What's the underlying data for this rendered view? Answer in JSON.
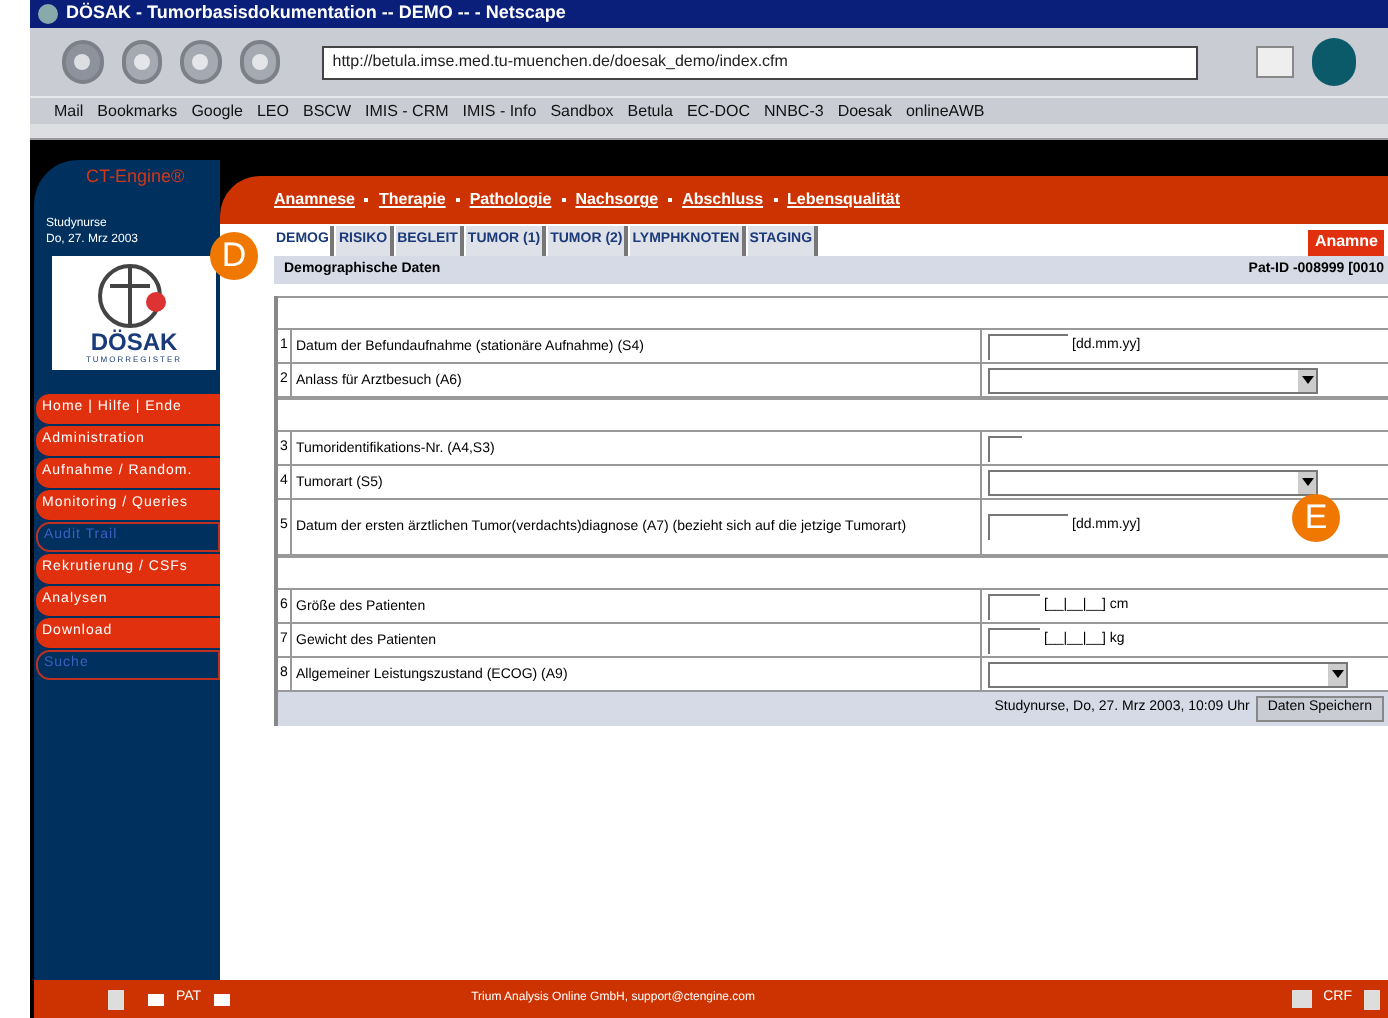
{
  "window": {
    "title": "DÖSAK - Tumorbasisdokumentation -- DEMO -- - Netscape"
  },
  "browser": {
    "url": "http://betula.imse.med.tu-muenchen.de/doesak_demo/index.cfm",
    "bookmarks": [
      "Mail",
      "Bookmarks",
      "Google",
      "LEO",
      "BSCW",
      "IMIS - CRM",
      "IMIS - Info",
      "Sandbox",
      "Betula",
      "EC-DOC",
      "NNBC-3",
      "Doesak",
      "onlineAWB"
    ]
  },
  "sidebar": {
    "brand": "CT-Engine®",
    "user": "Studynurse",
    "date": "Do, 27. Mrz 2003",
    "logo_text": "DÖSAK",
    "logo_subtext": "TUMORREGISTER",
    "items": [
      {
        "label": "Home  |  Hilfe  |  Ende",
        "disabled": false
      },
      {
        "label": "Administration",
        "disabled": false
      },
      {
        "label": "Aufnahme / Random.",
        "disabled": false
      },
      {
        "label": "Monitoring / Queries",
        "disabled": false
      },
      {
        "label": "Audit Trail",
        "disabled": true
      },
      {
        "label": "Rekrutierung / CSFs",
        "disabled": false
      },
      {
        "label": "Analysen",
        "disabled": false
      },
      {
        "label": "Download",
        "disabled": false
      },
      {
        "label": "Suche",
        "disabled": true
      }
    ]
  },
  "nav": [
    "Anamnese",
    "Therapie",
    "Pathologie",
    "Nachsorge",
    "Abschluss",
    "Lebensqualität"
  ],
  "tabs": [
    {
      "label": "DEMOG",
      "selected": true
    },
    {
      "label": "RISIKO",
      "selected": false
    },
    {
      "label": "BEGLEIT",
      "selected": false
    },
    {
      "label": "TUMOR (1)",
      "selected": false
    },
    {
      "label": "TUMOR (2)",
      "selected": false
    },
    {
      "label": "LYMPHKNOTEN",
      "selected": false
    },
    {
      "label": "STAGING",
      "selected": false
    }
  ],
  "section_button": "Anamne",
  "form": {
    "title": "Demographische Daten",
    "patient_id": "Pat-ID -008999 [0010",
    "rows": [
      {
        "kind": "spacer"
      },
      {
        "kind": "date",
        "number": "1",
        "label": "Datum der Befundaufnahme (stationäre Aufnahme) (S4)",
        "hint": "[dd.mm.yy]"
      },
      {
        "kind": "select",
        "number": "2",
        "label": "Anlass für Arztbesuch (A6)"
      },
      {
        "kind": "spacer"
      },
      {
        "kind": "short",
        "number": "3",
        "label": "Tumoridentifikations-Nr. (A4,S3)"
      },
      {
        "kind": "select",
        "number": "4",
        "label": "Tumorart (S5)"
      },
      {
        "kind": "date",
        "number": "5",
        "label": "Datum der ersten ärztlichen Tumor(verdachts)diagnose (A7) (bezieht sich auf die jetzige Tumorart)",
        "hint": "[dd.mm.yy]"
      },
      {
        "kind": "spacer"
      },
      {
        "kind": "measure",
        "number": "6",
        "label": "Größe des Patienten",
        "hint": "[__|__|__] cm"
      },
      {
        "kind": "measure",
        "number": "7",
        "label": "Gewicht des Patienten",
        "hint": "[__|__|__] kg"
      },
      {
        "kind": "wideselect",
        "number": "8",
        "label": "Allgemeiner Leistungszustand (ECOG) (A9)"
      }
    ],
    "footer": "Studynurse, Do, 27. Mrz 2003, 10:09 Uhr",
    "save_button": "Daten Speichern"
  },
  "callouts": [
    "D",
    "E"
  ],
  "bottom_bar": {
    "left": "PAT",
    "center": "Trium Analysis Online GmbH, support@ctengine.com",
    "right": "CRF"
  }
}
